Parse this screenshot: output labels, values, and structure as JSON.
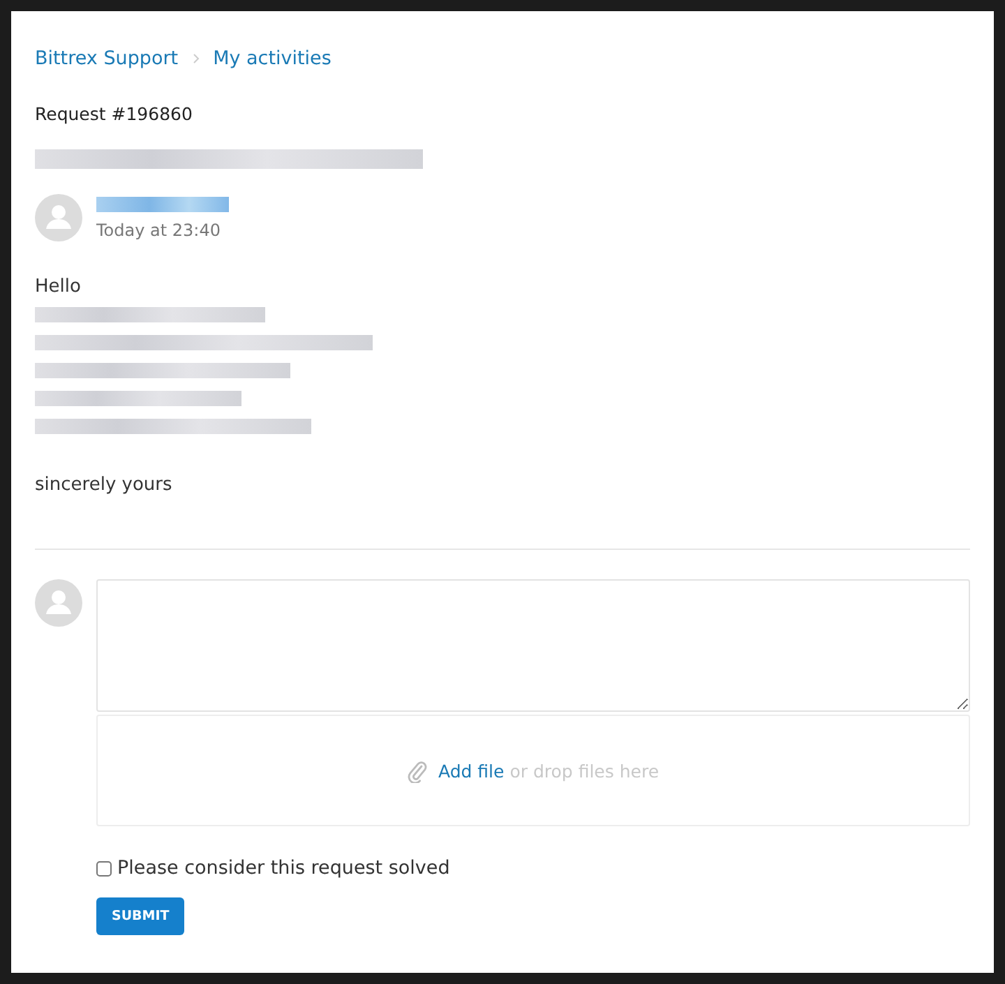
{
  "breadcrumbs": [
    {
      "label": "Bittrex Support"
    },
    {
      "label": "My activities"
    }
  ],
  "request": {
    "label": "Request #196860",
    "title": {
      "kind": "redacted"
    }
  },
  "comment": {
    "author": {
      "kind": "redacted"
    },
    "time": "Today at 23:40",
    "body": [
      {
        "kind": "text",
        "text": "Hello"
      },
      {
        "kind": "redacted"
      },
      {
        "kind": "redacted"
      },
      {
        "kind": "redacted"
      },
      {
        "kind": "redacted"
      },
      {
        "kind": "redacted"
      },
      {
        "kind": "gap"
      },
      {
        "kind": "text",
        "text": "sincerely yours"
      }
    ]
  },
  "reply": {
    "attach_link": "Add file",
    "attach_hint": "or drop files here",
    "solved": {
      "label": "Please consider this request solved",
      "checked": false
    },
    "submit": "SUBMIT"
  }
}
